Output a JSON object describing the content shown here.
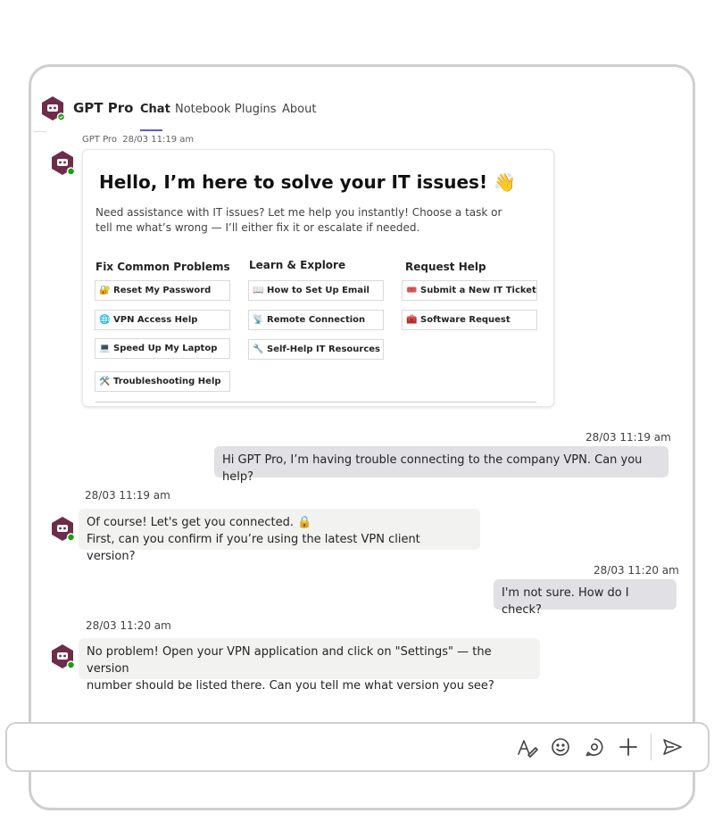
{
  "app": {
    "name": "GPT Pro",
    "tabs": [
      {
        "label": "Chat",
        "active": true
      },
      {
        "label": "Notebook",
        "active": false
      },
      {
        "label": "Plugins",
        "active": false
      },
      {
        "label": "About",
        "active": false
      }
    ]
  },
  "colors": {
    "accent": "#5b5fc7",
    "avatar": "#6e2b4a",
    "online": "#13a10e",
    "user_bubble": "#e0e0e5",
    "bot_bubble": "#f2f2f0"
  },
  "card": {
    "meta_sender": "GPT Pro",
    "meta_time": "28/03 11:19 am",
    "title": "Hello, I’m here to solve your IT issues! 👋",
    "description": "Need assistance with IT issues? Let me help you instantly! Choose a task or tell me what’s wrong — I’ll either fix it or escalate if needed.",
    "columns": [
      {
        "heading": "Fix Common Problems",
        "buttons": [
          {
            "icon": "🔐",
            "label": "Reset My Password"
          },
          {
            "icon": "🌐",
            "label": "VPN Access Help"
          },
          {
            "icon": "💻",
            "label": "Speed Up My Laptop"
          },
          {
            "icon": "🛠️",
            "label": "Troubleshooting Help"
          }
        ]
      },
      {
        "heading": "Learn & Explore",
        "buttons": [
          {
            "icon": "📖",
            "label": "How to Set Up Email"
          },
          {
            "icon": "📡",
            "label": "Remote Connection"
          },
          {
            "icon": "🔧",
            "label": "Self-Help IT Resources"
          }
        ]
      },
      {
        "heading": "Request Help",
        "buttons": [
          {
            "icon": "🎟️",
            "label": "Submit a New IT Ticket"
          },
          {
            "icon": "🧰",
            "label": "Software Request"
          }
        ]
      }
    ]
  },
  "messages": [
    {
      "from": "user",
      "time": "28/03 11:19 am",
      "text": "Hi GPT Pro, I’m having trouble connecting to the company VPN. Can you help?"
    },
    {
      "from": "bot",
      "time": "28/03 11:19 am",
      "line1": "Of course! Let's get you connected. 🔒",
      "line2": "First, can you confirm if you’re using the latest VPN client version?"
    },
    {
      "from": "user",
      "time": "28/03 11:20 am",
      "text": "I'm not sure. How do I check?"
    },
    {
      "from": "bot",
      "time": "28/03 11:20 am",
      "line1": "No problem! Open your VPN application and click on \"Settings\" — the version",
      "line2": "number should be listed there. Can you tell me what version you see?"
    }
  ],
  "composer": {
    "placeholder": "",
    "icons": [
      "format-icon",
      "emoji-icon",
      "loop-icon",
      "add-icon",
      "send-icon"
    ]
  }
}
